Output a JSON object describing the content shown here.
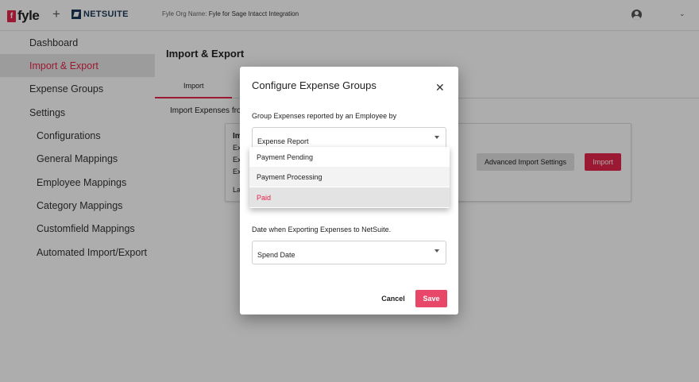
{
  "header": {
    "logo_box": "f",
    "logo_word": "fyle",
    "plus": "+",
    "netsuite_label": "NETSUITE",
    "org_key": "Fyle Org Name: ",
    "org_value": "Fyle for Sage Intacct Integration",
    "chevron": "⌄"
  },
  "sidebar": {
    "items": [
      {
        "label": "Dashboard"
      },
      {
        "label": "Import & Export"
      },
      {
        "label": "Expense Groups"
      },
      {
        "label": "Settings"
      },
      {
        "label": "Configurations"
      },
      {
        "label": "General Mappings"
      },
      {
        "label": "Employee Mappings"
      },
      {
        "label": "Category Mappings"
      },
      {
        "label": "Customfield Mappings"
      },
      {
        "label": "Automated Import/Export"
      }
    ],
    "active_index": 1
  },
  "main": {
    "title": "Import & Export",
    "tabs": [
      {
        "label": "Import"
      }
    ],
    "section_title": "Import Expenses fro",
    "card": {
      "heading": "Im",
      "lines": [
        "Ex",
        "Ex",
        "Ex"
      ],
      "footer": "La",
      "advanced_button": "Advanced Import Settings",
      "import_button": "Import"
    }
  },
  "dialog": {
    "title": "Configure Expense Groups",
    "close_icon": "✕",
    "group_label": "Group Expenses reported by an Employee by",
    "group_value": "Expense Report",
    "dropdown_options": [
      {
        "label": "Payment Pending"
      },
      {
        "label": "Payment Processing"
      },
      {
        "label": "Paid"
      }
    ],
    "date_label": "Date when Exporting Expenses to NetSuite.",
    "date_value": "Spend Date",
    "cancel_label": "Cancel",
    "save_label": "Save"
  },
  "colors": {
    "accent": "#e5254a",
    "overlay": "rgba(0,0,0,0.32)"
  },
  "icons": [
    "user-icon",
    "chevron-down-icon",
    "close-icon",
    "dropdown-arrow-icon"
  ]
}
